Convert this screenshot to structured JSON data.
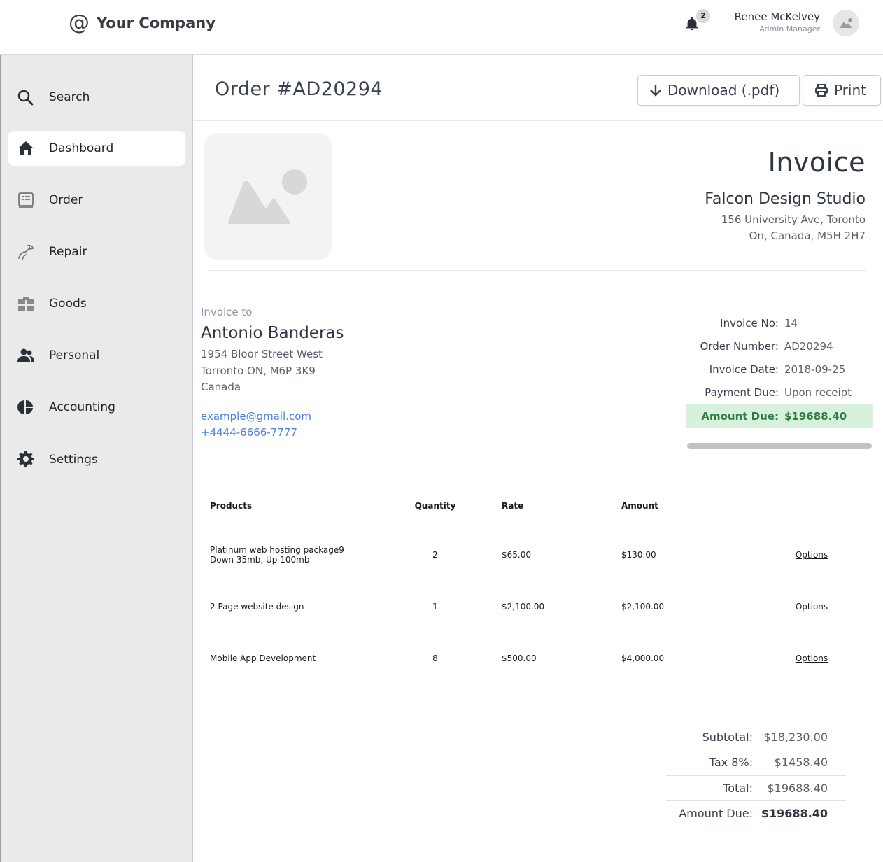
{
  "header": {
    "company": "Your Company",
    "notifications_count": "2",
    "user_name": "Renee McKelvey",
    "user_role": "Admin Manager"
  },
  "sidebar": {
    "items": [
      {
        "label": "Search",
        "icon": "search-icon"
      },
      {
        "label": "Dashboard",
        "icon": "home-icon",
        "active": true
      },
      {
        "label": "Order",
        "icon": "order-icon"
      },
      {
        "label": "Repair",
        "icon": "wrench-icon"
      },
      {
        "label": "Goods",
        "icon": "box-icon"
      },
      {
        "label": "Personal",
        "icon": "people-icon"
      },
      {
        "label": "Accounting",
        "icon": "pie-chart-icon"
      },
      {
        "label": "Settings",
        "icon": "gear-icon"
      }
    ]
  },
  "order": {
    "title": "Order #AD20294",
    "download_label": "Download (.pdf)",
    "print_label": "Print"
  },
  "invoice": {
    "title": "Invoice",
    "company": "Falcon Design Studio",
    "address_line1": "156 University Ave, Toronto",
    "address_line2": "On, Canada, M5H 2H7"
  },
  "bill_to": {
    "label": "Invoice to",
    "name": "Antonio Banderas",
    "line1": "1954 Bloor Street West",
    "line2": "Torronto ON, M6P 3K9",
    "line3": "Canada",
    "email": "example@gmail.com",
    "phone": "+4444-6666-7777"
  },
  "meta": {
    "invoice_no_label": "Invoice No:",
    "invoice_no": "14",
    "order_number_label": "Order Number:",
    "order_number": "AD20294",
    "invoice_date_label": "Invoice Date:",
    "invoice_date": "2018-09-25",
    "payment_due_label": "Payment Due:",
    "payment_due": "Upon receipt",
    "amount_due_label": "Amount Due:",
    "amount_due": "$19688.40"
  },
  "table": {
    "headers": {
      "products": "Products",
      "quantity": "Quantity",
      "rate": "Rate",
      "amount": "Amount"
    },
    "rows": [
      {
        "product": "Platinum web hosting package9",
        "product_sub": "Down 35mb, Up 100mb",
        "quantity": "2",
        "rate": "$65.00",
        "amount": "$130.00",
        "options": "Options"
      },
      {
        "product": "2 Page website design",
        "product_sub": "",
        "quantity": "1",
        "rate": "$2,100.00",
        "amount": "$2,100.00",
        "options": "Options"
      },
      {
        "product": "Mobile App Development",
        "product_sub": "",
        "quantity": "8",
        "rate": "$500.00",
        "amount": "$4,000.00",
        "options": "Options"
      }
    ]
  },
  "totals": {
    "subtotal_label": "Subtotal:",
    "subtotal": "$18,230.00",
    "tax_label": "Tax 8%:",
    "tax": "$1458.40",
    "total_label": "Total:",
    "total": "$19688.40",
    "amount_due_label": "Amount Due:",
    "amount_due": "$19688.40"
  },
  "colors": {
    "accent_link": "#4a80d6",
    "amount_due_bg": "#d8f1dd",
    "amount_due_text": "#2f7d44",
    "sidebar_bg": "#eaeaea"
  }
}
